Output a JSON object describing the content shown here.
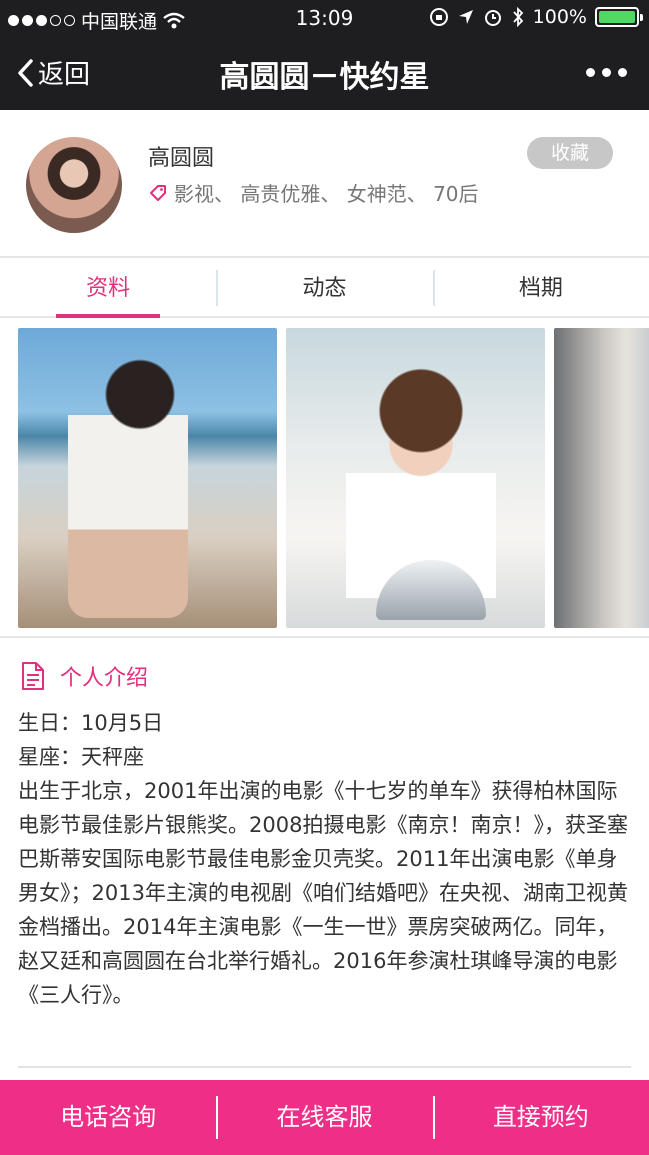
{
  "status_bar": {
    "carrier": "中国联通",
    "time": "13:09",
    "battery": "100%"
  },
  "nav": {
    "back_label": "返回",
    "title": "高圆圆－快约星"
  },
  "profile": {
    "name": "高圆圆",
    "tags": "影视、 高贵优雅、 女神范、 70后",
    "collect_label": "收藏"
  },
  "tabs": [
    {
      "label": "资料",
      "active": true
    },
    {
      "label": "动态",
      "active": false
    },
    {
      "label": "档期",
      "active": false
    }
  ],
  "intro": {
    "heading": "个人介绍",
    "birthday": "生日：10月5日",
    "constellation": "星座：天秤座",
    "bio": "出生于北京，2001年出演的电影《十七岁的单车》获得柏林国际电影节最佳影片银熊奖。2008拍摄电影《南京！南京！》，获圣塞巴斯蒂安国际电影节最佳电影金贝壳奖。2011年出演电影《单身男女》；2013年主演的电视剧《咱们结婚吧》在央视、湖南卫视黄金档播出。2014年主演电影《一生一世》票房突破两亿。同年，赵又廷和高圆圆在台北举行婚礼。2016年参演杜琪峰导演的电影《三人行》。"
  },
  "bottom_bar": {
    "call_label": "电话咨询",
    "service_label": "在线客服",
    "book_label": "直接预约"
  },
  "colors": {
    "accent": "#e0317d",
    "bottom_bar": "#ef2e88",
    "nav_bg": "#1e1e20",
    "battery": "#4cd964"
  }
}
